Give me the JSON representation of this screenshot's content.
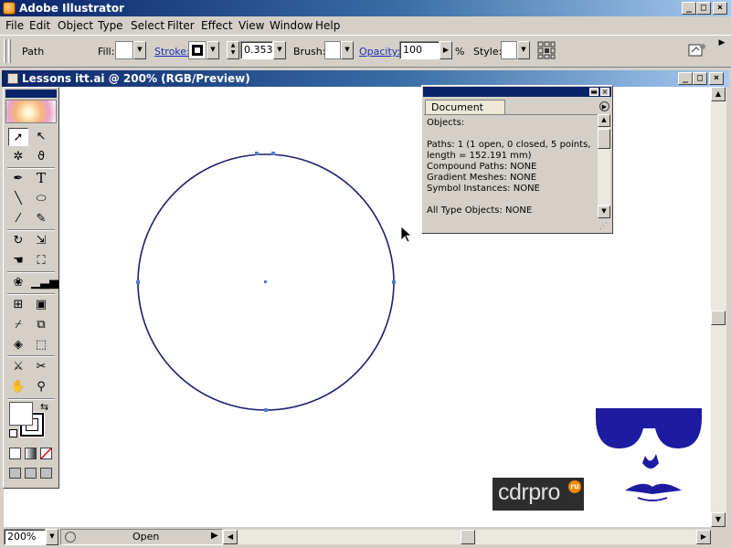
{
  "app": {
    "title": "Adobe Illustrator"
  },
  "menu": [
    "File",
    "Edit",
    "Object",
    "Type",
    "Select",
    "Filter",
    "Effect",
    "View",
    "Window",
    "Help"
  ],
  "control": {
    "object_type": "Path",
    "fill_label": "Fill:",
    "stroke_label": "Stroke:",
    "stroke_weight": "0.353",
    "brush_label": "Brush:",
    "opacity_label": "Opacity:",
    "opacity_value": "100",
    "opacity_unit": "%",
    "style_label": "Style:"
  },
  "document": {
    "title": "Lessons itt.ai @ 200% (RGB/Preview)",
    "zoom": "200%",
    "status": "Open"
  },
  "doc_info": {
    "tab": "Document Info",
    "lines": [
      "Objects:",
      "",
      "Paths: 1 (1 open, 0 closed, 5 points,",
      "length = 152.191 mm)",
      "Compound Paths: NONE",
      "Gradient Meshes: NONE",
      "Symbol Instances: NONE",
      "",
      "All Type Objects: NONE"
    ]
  },
  "watermark": {
    "text": "cdrpro",
    "badge": "ru"
  },
  "colors": {
    "title_bar": "#0a246a",
    "ui_gray": "#d4d0c8",
    "path_stroke": "#1c1f6e",
    "anchor": "#4f7fd6",
    "mascot": "#1d1ba0"
  },
  "icons": [
    "selection-tool",
    "direct-selection-tool",
    "magic-wand-tool",
    "lasso-tool",
    "pen-tool",
    "type-tool",
    "line-tool",
    "ellipse-tool",
    "paintbrush-tool",
    "pencil-tool",
    "rotate-tool",
    "scale-tool",
    "warp-tool",
    "free-transform-tool",
    "symbol-sprayer-tool",
    "graph-tool",
    "mesh-tool",
    "gradient-tool",
    "eyedropper-tool",
    "blend-tool",
    "live-paint-tool",
    "live-paint-selection-tool",
    "slice-tool",
    "scissors-tool",
    "hand-tool",
    "zoom-tool"
  ]
}
